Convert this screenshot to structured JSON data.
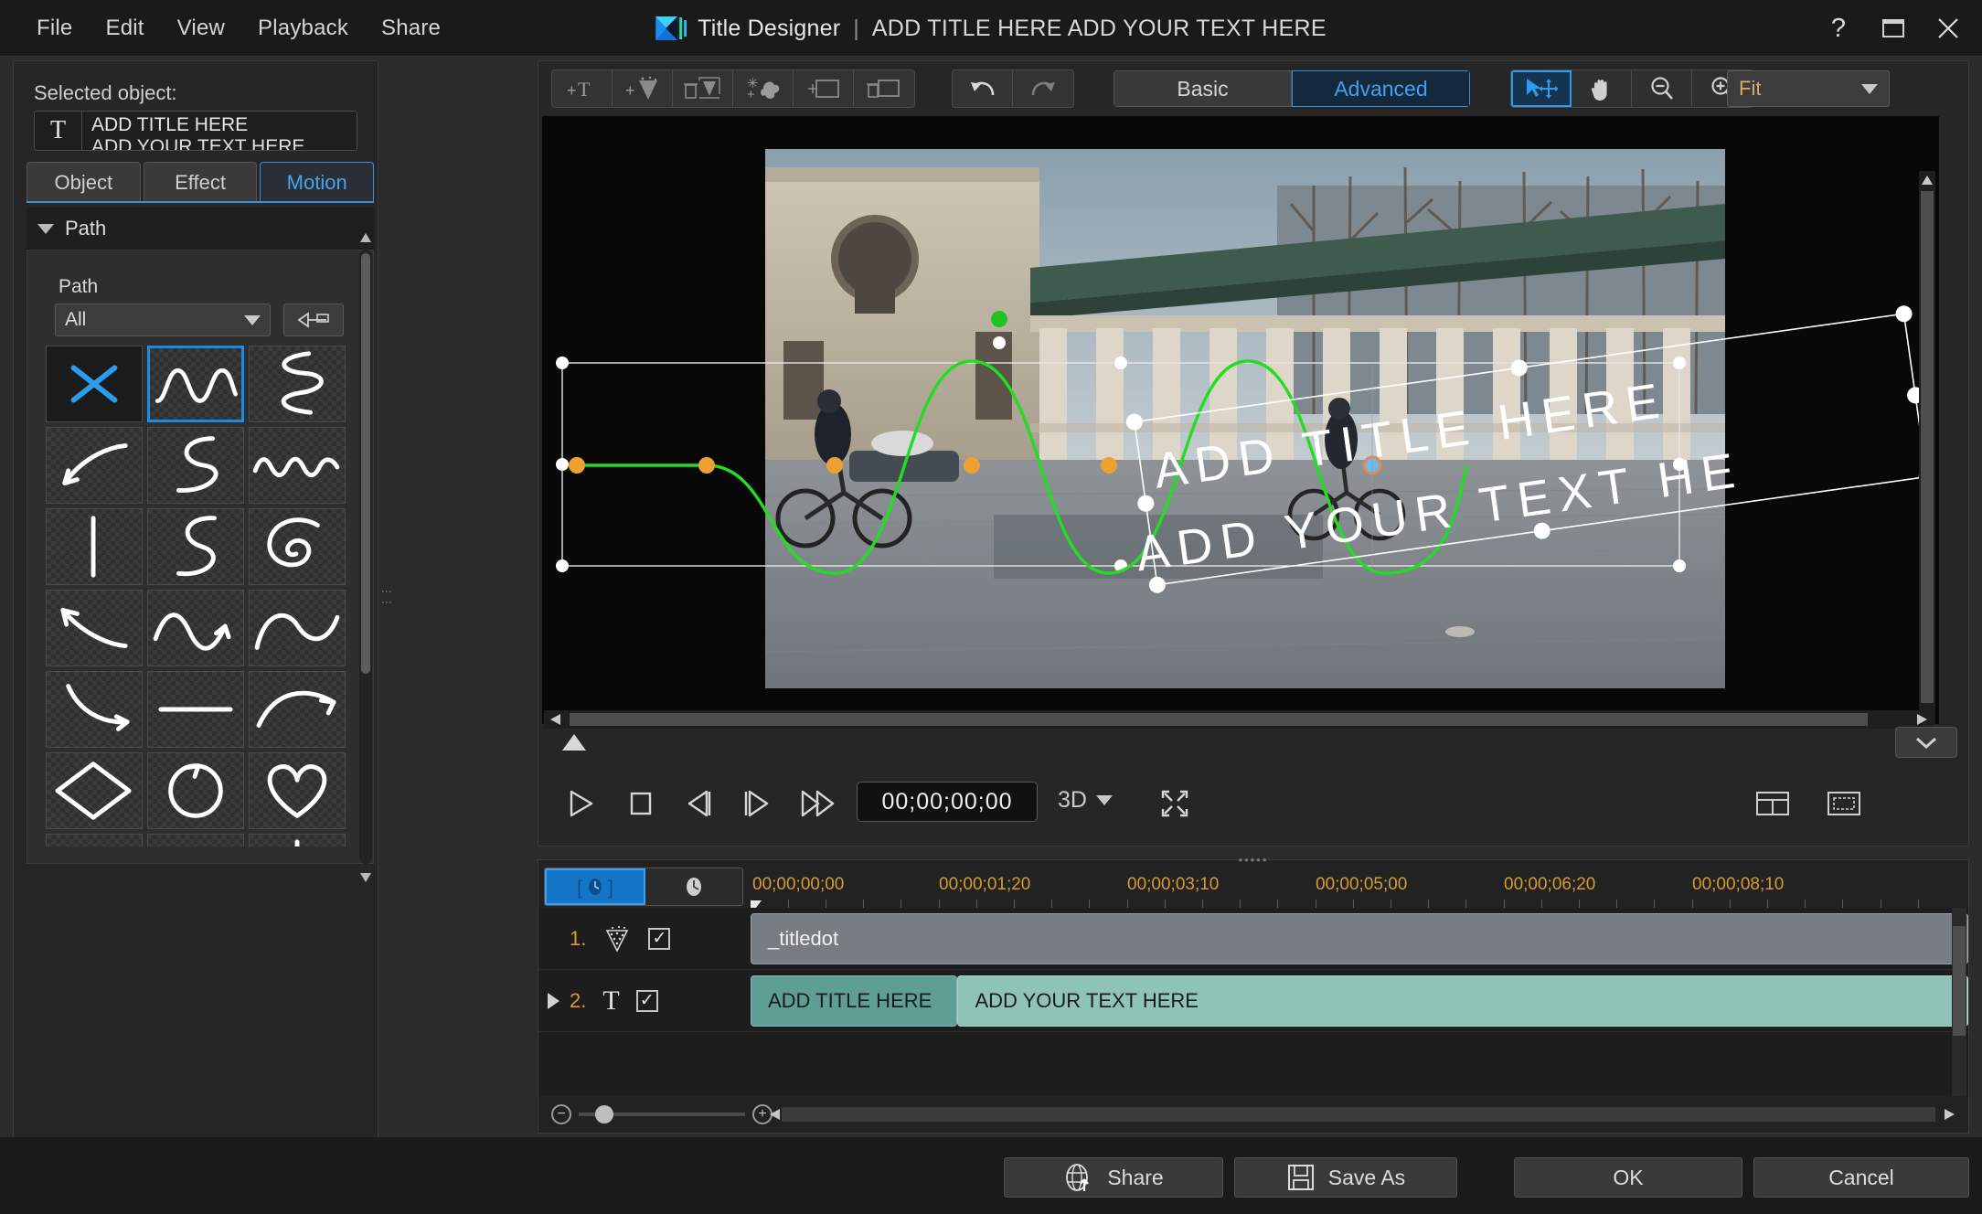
{
  "window": {
    "app_name": "Title Designer",
    "separator": "|",
    "document_title": "ADD TITLE HERE ADD YOUR TEXT HERE",
    "help_label": "?",
    "maximize_label": "maximize",
    "close_label": "close"
  },
  "menubar": {
    "items": [
      {
        "label": "File"
      },
      {
        "label": "Edit"
      },
      {
        "label": "View"
      },
      {
        "label": "Playback"
      },
      {
        "label": "Share"
      }
    ]
  },
  "left_panel": {
    "selected_object_label": "Selected object:",
    "selected_object": {
      "icon": "text-T-icon",
      "line1": "ADD TITLE HERE",
      "line2": "ADD YOUR TEXT HERE"
    },
    "tabs": [
      {
        "label": "Object",
        "active": false
      },
      {
        "label": "Effect",
        "active": false
      },
      {
        "label": "Motion",
        "active": true
      }
    ],
    "section": {
      "title": "Path",
      "expanded": true,
      "field_label": "Path",
      "dropdown_value": "All",
      "dropdown_options": [
        "All"
      ],
      "add_path_button": "add-custom-path-icon"
    },
    "path_thumbnails": [
      {
        "name": "no-path",
        "kind": "none",
        "selected": false
      },
      {
        "name": "wave-sine",
        "kind": "sine",
        "selected": true
      },
      {
        "name": "zigzag-curve",
        "kind": "squiggle-vert",
        "selected": false
      },
      {
        "name": "arc-arrow-left",
        "kind": "arc-arrow",
        "selected": false
      },
      {
        "name": "s-curve",
        "kind": "s-curve",
        "selected": false
      },
      {
        "name": "wave-small",
        "kind": "wave-small",
        "selected": false
      },
      {
        "name": "vertical-line",
        "kind": "v-line",
        "selected": false
      },
      {
        "name": "s-curve-2",
        "kind": "s-curve2",
        "selected": false
      },
      {
        "name": "spiral",
        "kind": "spiral",
        "selected": false
      },
      {
        "name": "arrow-left-curve",
        "kind": "arrow-left",
        "selected": false
      },
      {
        "name": "wave-arrow",
        "kind": "wave-arrow",
        "selected": false
      },
      {
        "name": "hill-curve",
        "kind": "hill",
        "selected": false
      },
      {
        "name": "curve-down-arrow",
        "kind": "curve-down",
        "selected": false
      },
      {
        "name": "horizontal-arrow",
        "kind": "h-arrow",
        "selected": false
      },
      {
        "name": "swoosh-arrow",
        "kind": "swoosh",
        "selected": false
      },
      {
        "name": "diamond",
        "kind": "diamond",
        "selected": false
      },
      {
        "name": "circle-arrow",
        "kind": "circle",
        "selected": false
      },
      {
        "name": "heart",
        "kind": "heart",
        "selected": false
      },
      {
        "name": "double-hump",
        "kind": "hump2",
        "selected": false
      },
      {
        "name": "square-bracket-path",
        "kind": "bracket",
        "selected": false
      },
      {
        "name": "dashed-down-arrow",
        "kind": "dashed-arrow",
        "selected": false
      }
    ]
  },
  "preview": {
    "toolbar_left": [
      {
        "name": "add-text-button",
        "icon": "+T"
      },
      {
        "name": "add-particle-button",
        "icon": "+particle"
      },
      {
        "name": "delete-particle-button",
        "icon": "trash-particle"
      },
      {
        "name": "add-effect-button",
        "icon": "sparkle-plus"
      },
      {
        "name": "add-object-button",
        "icon": "add-frame"
      },
      {
        "name": "delete-object-button",
        "icon": "trash-frame"
      }
    ],
    "toolbar_history": [
      {
        "name": "undo-button",
        "icon": "undo",
        "enabled": true
      },
      {
        "name": "redo-button",
        "icon": "redo",
        "enabled": false
      }
    ],
    "mode_tabs": [
      {
        "label": "Basic",
        "active": false
      },
      {
        "label": "Advanced",
        "active": true
      }
    ],
    "view_tools": [
      {
        "name": "select-move-tool",
        "icon": "pointer-move",
        "active": true
      },
      {
        "name": "pan-tool",
        "icon": "hand",
        "active": false
      },
      {
        "name": "zoom-out-tool",
        "icon": "magnifier-minus",
        "active": false
      },
      {
        "name": "zoom-in-tool",
        "icon": "magnifier-plus",
        "active": false
      }
    ],
    "zoom_level": "Fit",
    "zoom_options": [
      "Fit"
    ],
    "canvas_text": {
      "line1": "ADD TITLE HERE",
      "line2": "ADD YOUR TEXT HE"
    },
    "motion_path_color": "#22dd22",
    "keyframe_color": "#f0a030",
    "playhead_keyframe_color": "#4aa3ef"
  },
  "playback": {
    "buttons": [
      {
        "name": "play-button",
        "icon": "play"
      },
      {
        "name": "stop-button",
        "icon": "stop"
      },
      {
        "name": "prev-frame-button",
        "icon": "prev-frame"
      },
      {
        "name": "next-frame-button",
        "icon": "next-frame"
      },
      {
        "name": "fast-forward-button",
        "icon": "fast-forward"
      }
    ],
    "timecode": "00;00;00;00",
    "mode_3d": "3D",
    "fullscreen_icon": "expand-arrows",
    "grid_icon": "grid-view",
    "tv_icon": "tv-safe-zone"
  },
  "timeline": {
    "toggle": [
      {
        "name": "keyframe-mode",
        "icon": "[clock]",
        "active": true
      },
      {
        "name": "clock-mode",
        "icon": "clock",
        "active": false
      }
    ],
    "ruler_labels": [
      "00;00;00;00",
      "00;00;01;20",
      "00;00;03;10",
      "00;00;05;00",
      "00;00;06;20",
      "00;00;08;10"
    ],
    "tracks": [
      {
        "number": "1.",
        "icon": "particle-icon",
        "checked": true,
        "expandable": false,
        "clips": [
          {
            "label": "_titledot",
            "style": "grey",
            "left_pct": 0,
            "width_pct": 100
          }
        ]
      },
      {
        "number": "2.",
        "icon": "text-T-icon",
        "checked": true,
        "expandable": true,
        "clips": [
          {
            "label": "ADD TITLE HERE",
            "style": "teal-dark",
            "left_pct": 0,
            "width_pct": 17
          },
          {
            "label": "ADD YOUR TEXT HERE",
            "style": "teal-light",
            "left_pct": 17,
            "width_pct": 83
          }
        ]
      }
    ]
  },
  "bottom_bar": {
    "buttons": [
      {
        "label": "Share",
        "icon": "globe-upload-icon",
        "name": "share-button"
      },
      {
        "label": "Save As",
        "icon": "floppy-disk-icon",
        "name": "save-as-button"
      },
      {
        "label": "OK",
        "icon": "",
        "name": "ok-button"
      },
      {
        "label": "Cancel",
        "icon": "",
        "name": "cancel-button"
      }
    ]
  },
  "colors": {
    "accent_blue": "#3c8ddb",
    "amber": "#d79b2e",
    "path_green": "#22dd22",
    "keyframe_orange": "#f0a030"
  }
}
